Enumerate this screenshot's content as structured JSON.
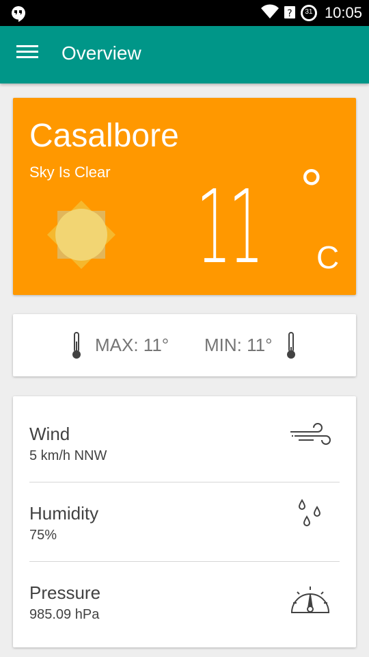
{
  "status_bar": {
    "time": "10:05",
    "calendar_day": "31",
    "icons": [
      "hangouts-icon",
      "wifi-icon",
      "signal-icon",
      "calendar-icon"
    ]
  },
  "app_bar": {
    "title": "Overview",
    "menu_icon": "hamburger-menu-icon",
    "color": "#009688"
  },
  "current": {
    "city": "Casalbore",
    "description": "Sky Is Clear",
    "icon": "sun-icon",
    "temperature": "11",
    "degree_symbol": "°",
    "unit": "C",
    "card_color": "#ff9800"
  },
  "min_max": {
    "max_label": "MAX: 11°",
    "min_label": "MIN: 11°",
    "icon": "thermometer-icon"
  },
  "details": [
    {
      "title": "Wind",
      "value": "5 km/h   NNW",
      "icon": "wind-icon"
    },
    {
      "title": "Humidity",
      "value": "75%",
      "icon": "raindrops-icon"
    },
    {
      "title": "Pressure",
      "value": "985.09 hPa",
      "icon": "gauge-icon"
    }
  ]
}
